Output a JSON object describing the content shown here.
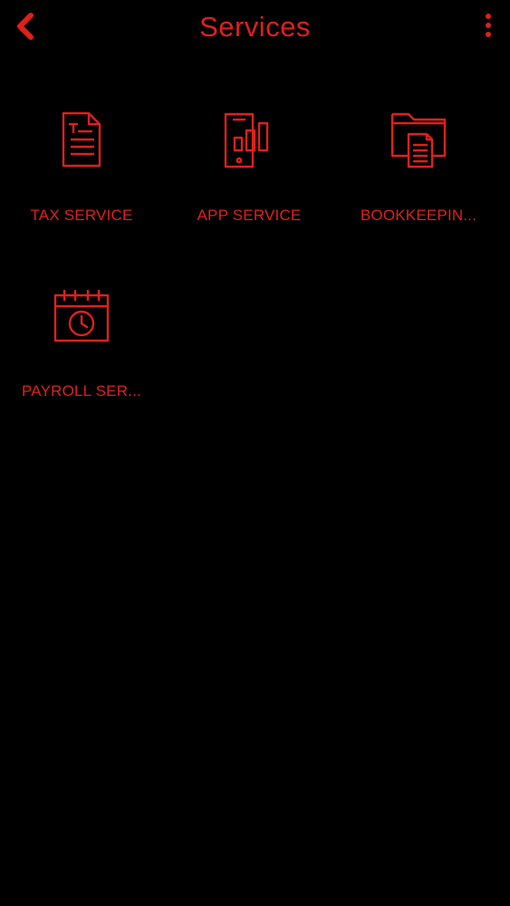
{
  "header": {
    "title": "Services",
    "back_icon": "chevron-left-icon",
    "menu_icon": "more-vertical-icon"
  },
  "colors": {
    "accent": "#e0201a",
    "background": "#000000"
  },
  "services": [
    {
      "label": "TAX SERVICE",
      "icon": "tax-document-icon"
    },
    {
      "label": "APP SERVICE",
      "icon": "mobile-chart-icon"
    },
    {
      "label": "BOOKKEEPIN...",
      "icon": "folder-document-icon"
    },
    {
      "label": "PAYROLL SER...",
      "icon": "calendar-clock-icon"
    }
  ]
}
